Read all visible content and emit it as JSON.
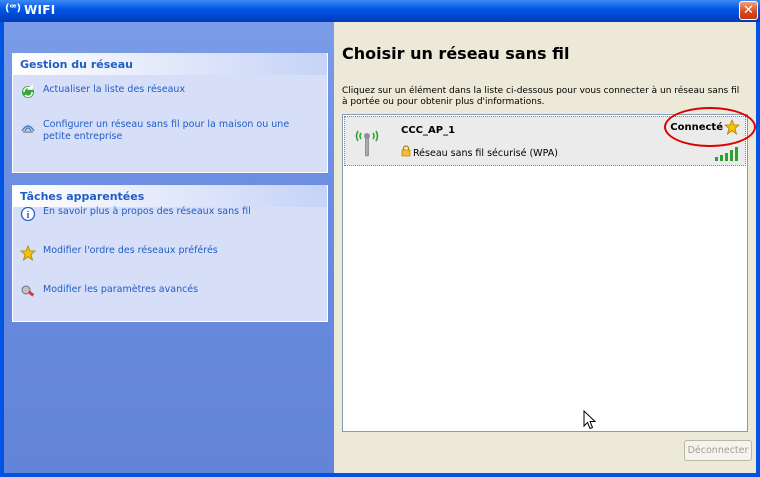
{
  "window": {
    "title": "WIFI",
    "title_icon": "(ꟹ)"
  },
  "sidebar": {
    "network_tasks": {
      "title": "Gestion du réseau",
      "items": [
        {
          "label": "Actualiser la liste des réseaux",
          "icon": "refresh-icon"
        },
        {
          "label": "Configurer un réseau sans fil pour la maison ou une petite entreprise",
          "icon": "setup-network-icon"
        }
      ]
    },
    "related_tasks": {
      "title": "Tâches apparentées",
      "items": [
        {
          "label": "En savoir plus à propos des réseaux sans fil",
          "icon": "info-icon"
        },
        {
          "label": "Modifier l'ordre des réseaux préférés",
          "icon": "star-icon"
        },
        {
          "label": "Modifier les paramètres avancés",
          "icon": "settings-icon"
        }
      ]
    }
  },
  "main": {
    "heading": "Choisir un réseau sans fil",
    "description": "Cliquez sur un élément dans la liste ci-dessous pour vous connecter à un réseau sans fil à portée ou pour obtenir plus d'informations.",
    "networks": [
      {
        "ssid": "CCC_AP_1",
        "security": "Réseau sans fil sécurisé (WPA)",
        "status": "Connecté",
        "signal_bars": 5
      }
    ],
    "disconnect_label": "Déconnecter"
  },
  "colors": {
    "title_blue": "#0054e3",
    "link_blue": "#215dc6",
    "annotation_red": "#d00000"
  }
}
